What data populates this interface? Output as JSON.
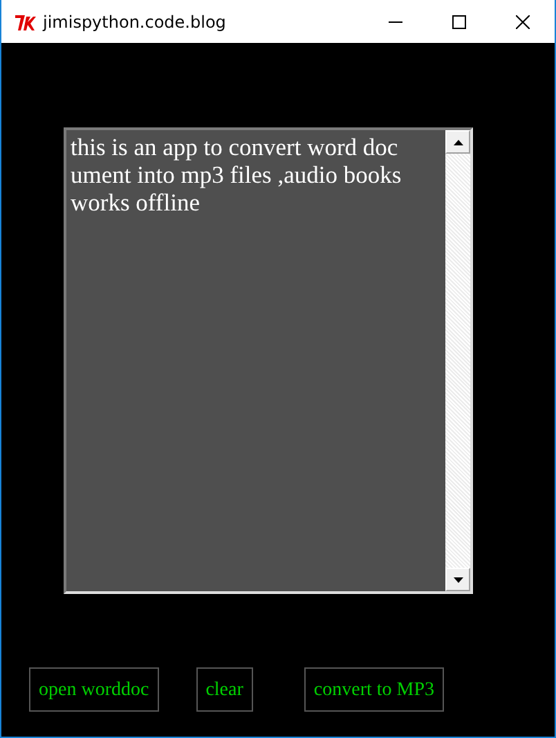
{
  "window": {
    "title": "jimispython.code.blog"
  },
  "text_area": {
    "lines": [
      "this is an app to convert word doc",
      "ument into mp3 files ,audio books",
      "works offline"
    ]
  },
  "buttons": [
    {
      "label": "open worddoc"
    },
    {
      "label": "clear"
    },
    {
      "label": "convert to MP3"
    }
  ]
}
